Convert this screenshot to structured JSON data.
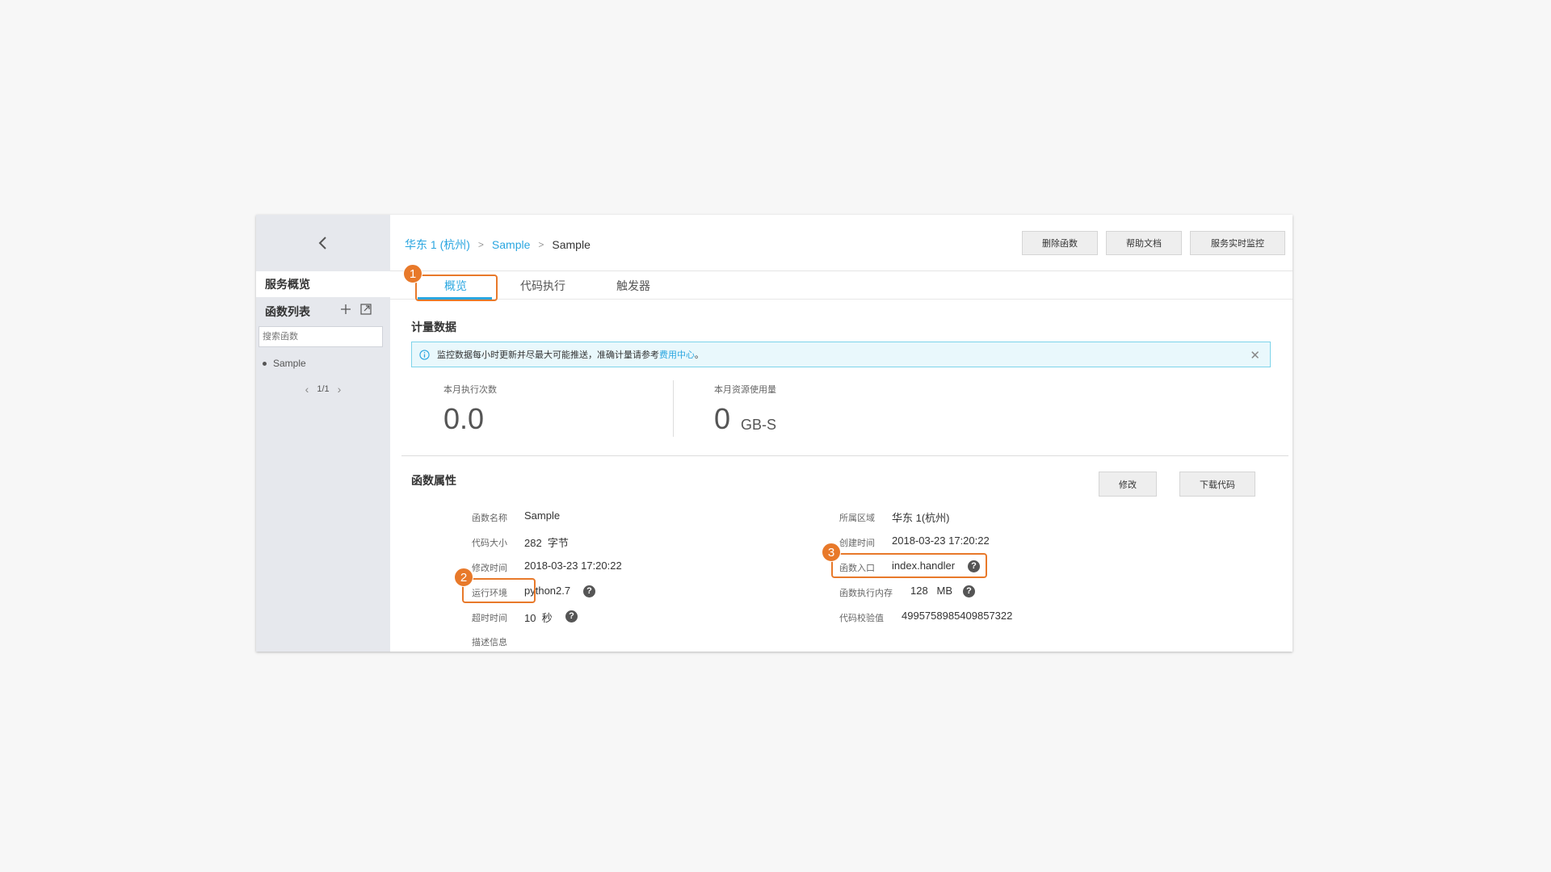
{
  "sidebar": {
    "overview": "服务概览",
    "function_list": "函数列表",
    "search_placeholder": "搜索函数",
    "items": [
      "Sample"
    ],
    "pager": "1/1"
  },
  "breadcrumb": {
    "region": "华东 1 (杭州)",
    "service": "Sample",
    "current": "Sample"
  },
  "toolbar": {
    "delete": "删除函数",
    "help": "帮助文档",
    "monitor": "服务实时监控"
  },
  "tabs": [
    "概览",
    "代码执行",
    "触发器"
  ],
  "metering": {
    "title": "计量数据",
    "notice_text": "监控数据每小时更新并尽最大可能推送，准确计量请参考",
    "notice_link": "费用中心",
    "notice_end": "。",
    "exec_label": "本月执行次数",
    "exec_value": "0.0",
    "usage_label": "本月资源使用量",
    "usage_value": "0",
    "usage_unit": "GB-S"
  },
  "properties": {
    "title": "函数属性",
    "edit": "修改",
    "download": "下载代码",
    "left": [
      {
        "label": "函数名称",
        "value": "Sample"
      },
      {
        "label": "代码大小",
        "value": "282  字节"
      },
      {
        "label": "修改时间",
        "value": "2018-03-23 17:20:22"
      },
      {
        "label": "运行环境",
        "value": "python2.7"
      },
      {
        "label": "超时时间",
        "value": "10  秒"
      },
      {
        "label": "描述信息",
        "value": ""
      }
    ],
    "right": [
      {
        "label": "所属区域",
        "value": "华东 1(杭州)"
      },
      {
        "label": "创建时间",
        "value": "2018-03-23 17:20:22"
      },
      {
        "label": "函数入口",
        "value": "index.handler"
      },
      {
        "label": "函数执行内存",
        "value": "128   MB"
      },
      {
        "label": "代码校验值",
        "value": "4995758985409857322"
      }
    ]
  },
  "badges": [
    "1",
    "2",
    "3"
  ],
  "colors": {
    "accent": "#2aa6e0",
    "highlight": "#e8792a"
  },
  "icons": [
    "chevron-left-icon",
    "plus-icon",
    "expand-icon",
    "info-icon",
    "close-icon",
    "help-icon"
  ]
}
